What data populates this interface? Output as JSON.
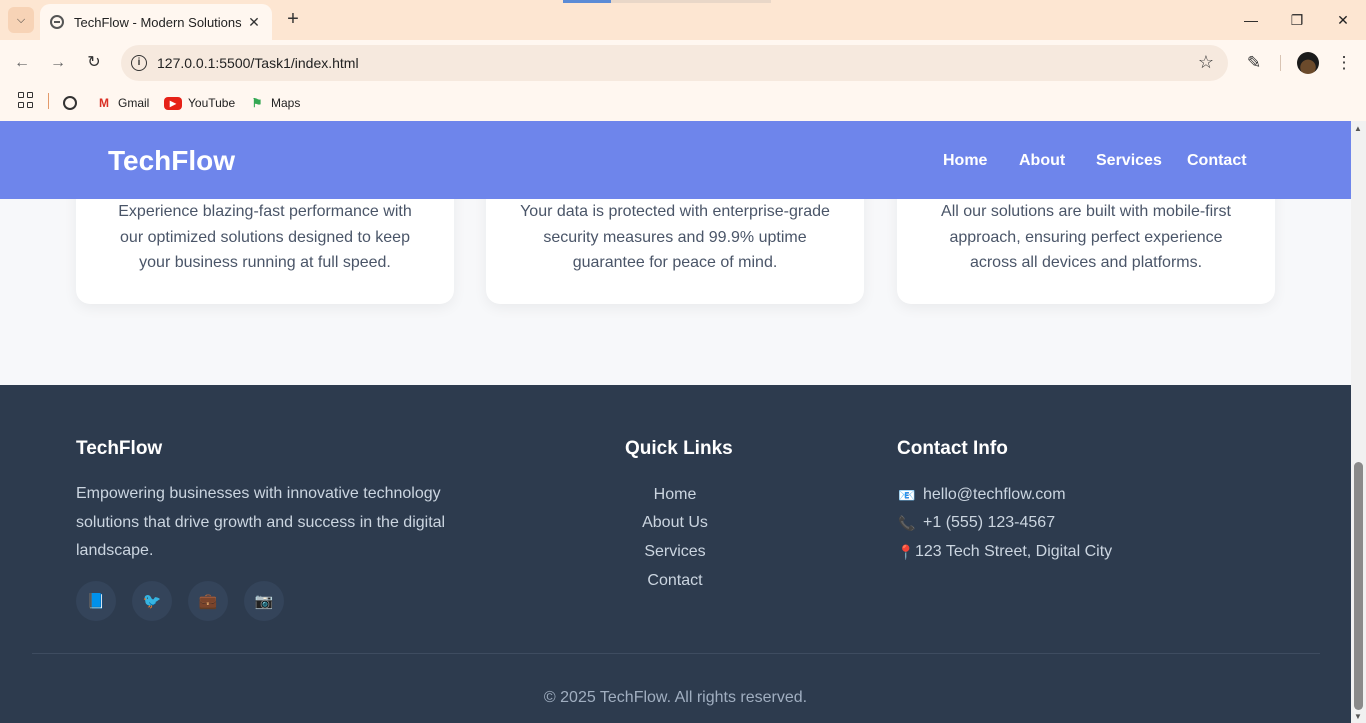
{
  "browser": {
    "tab_title": "TechFlow - Modern Solutions",
    "url": "127.0.0.1:5500/Task1/index.html",
    "bookmarks": [
      {
        "label": "Gmail"
      },
      {
        "label": "YouTube"
      },
      {
        "label": "Maps"
      }
    ]
  },
  "header": {
    "logo": "TechFlow",
    "nav": [
      "Home",
      "About",
      "Services",
      "Contact"
    ]
  },
  "cards": [
    {
      "text": "Experience blazing-fast performance with our optimized solutions designed to keep your business running at full speed."
    },
    {
      "text": "Your data is protected with enterprise-grade security measures and 99.9% uptime guarantee for peace of mind."
    },
    {
      "text": "All our solutions are built with mobile-first approach, ensuring perfect experience across all devices and platforms."
    }
  ],
  "footer": {
    "brand": "TechFlow",
    "description": "Empowering businesses with innovative technology solutions that drive growth and success in the digital landscape.",
    "social": [
      "📘",
      "🐦",
      "💼",
      "📷"
    ],
    "quick_links_heading": "Quick Links",
    "quick_links": [
      "Home",
      "About Us",
      "Services",
      "Contact"
    ],
    "contact_heading": "Contact Info",
    "contact": [
      {
        "icon": "📧",
        "text": "hello@techflow.com"
      },
      {
        "icon": "📞",
        "text": "+1 (555) 123-4567"
      },
      {
        "icon": "📍",
        "text": "123 Tech Street, Digital City"
      }
    ],
    "copyright": "© 2025 TechFlow. All rights reserved."
  },
  "colors": {
    "header_bg": "#667eea",
    "footer_bg": "#2d3b4e",
    "page_bg": "#f7f8fa"
  }
}
